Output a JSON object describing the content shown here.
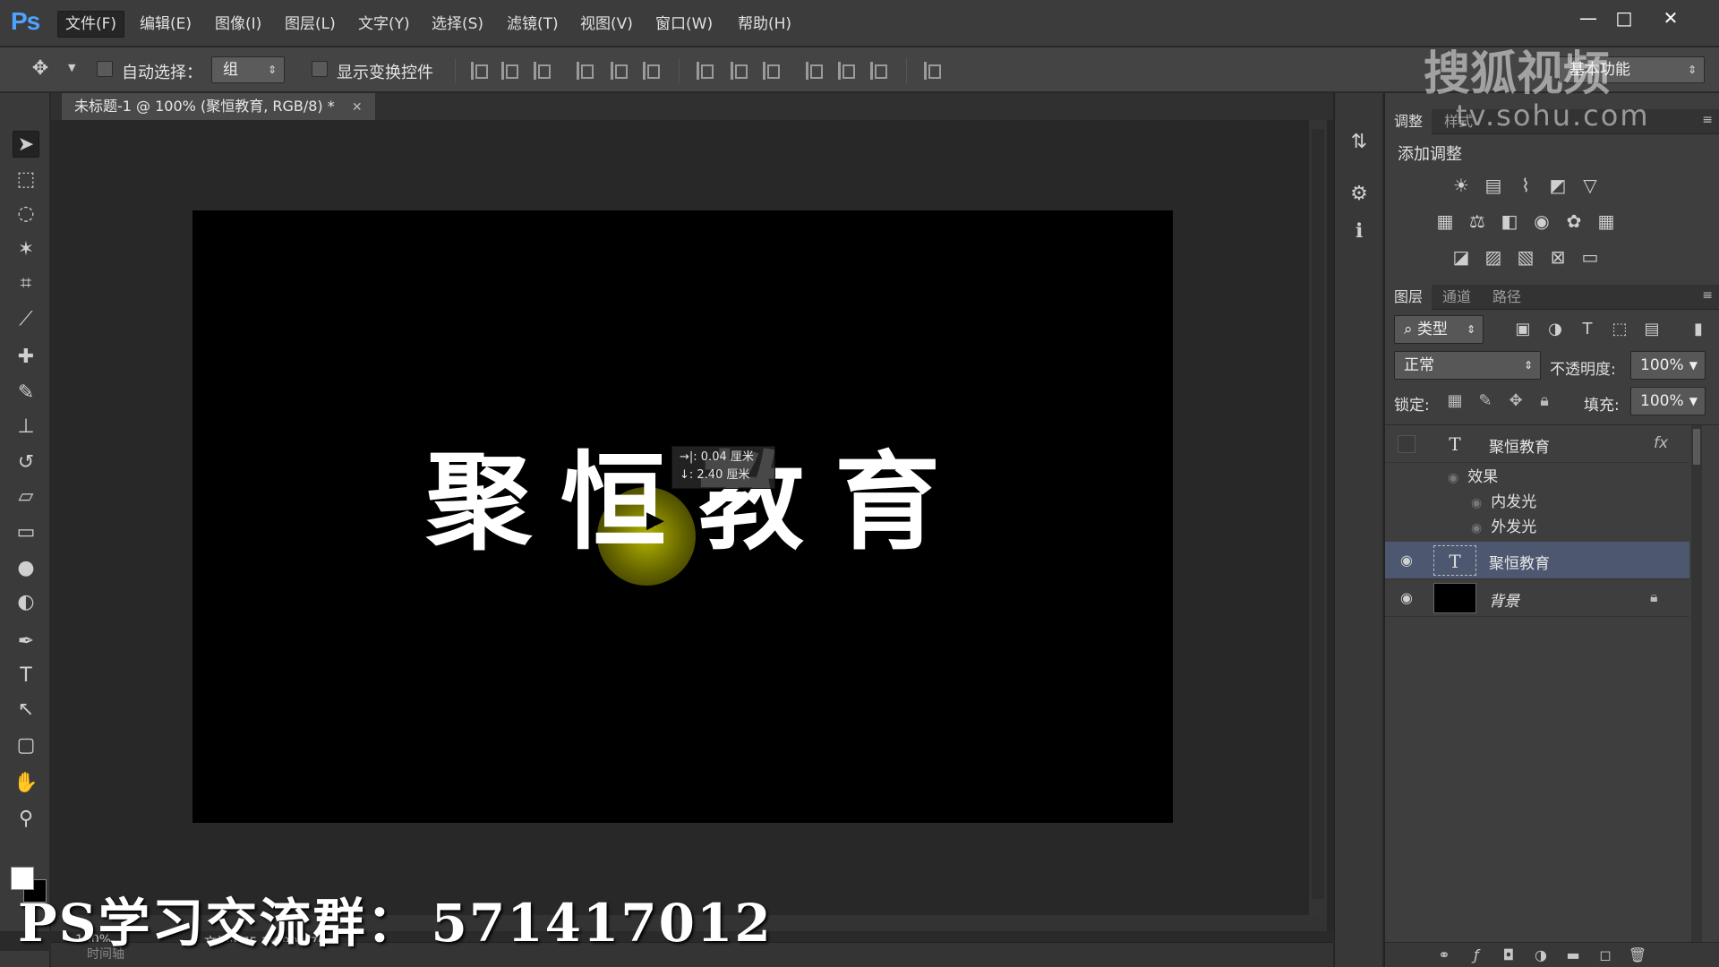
{
  "app": {
    "logo": "Ps",
    "menu": [
      "文件(F)",
      "编辑(E)",
      "图像(I)",
      "图层(L)",
      "文字(Y)",
      "选择(S)",
      "滤镜(T)",
      "视图(V)",
      "窗口(W)",
      "帮助(H)"
    ],
    "window_controls": [
      "—",
      "□",
      "✕"
    ]
  },
  "options_bar": {
    "auto_select_label": "自动选择：",
    "auto_select_value": "组",
    "show_transform_label": "显示变换控件",
    "workspace_value": "基本功能"
  },
  "document": {
    "tab_title": "未标题-1 @ 100% (聚恒教育, RGB/8) *",
    "canvas_chars": [
      "聚",
      "恒",
      "教",
      "育"
    ],
    "measure_tip": {
      "line1": "→|: 0.04 厘米",
      "line2": "↓: 2.40 厘米"
    },
    "status_zoom": "100%",
    "status_doc": "文档:975.3K/909.7K",
    "timeline_label": "时间轴"
  },
  "adjustments": {
    "tabs": [
      "调整",
      "样式"
    ],
    "add_label": "添加调整"
  },
  "layers": {
    "tabs": [
      "图层",
      "通道",
      "路径"
    ],
    "filter_kind": "类型",
    "blend_mode": "正常",
    "opacity_label": "不透明度:",
    "opacity_value": "100%",
    "lock_label": "锁定:",
    "fill_label": "填充:",
    "fill_value": "100%",
    "rows": [
      {
        "name": "聚恒教育",
        "fx": "fx"
      },
      {
        "name": "效果"
      },
      {
        "name": "内发光"
      },
      {
        "name": "外发光"
      },
      {
        "name": "聚恒教育"
      },
      {
        "name": "背景"
      }
    ]
  },
  "overlay": {
    "watermark_main": "搜狐视频",
    "watermark_sub": "tv.sohu.com",
    "caption": "PS学习交流群：",
    "group_number": "571417012"
  },
  "colors": {
    "accent_blue": "#4fa3ff",
    "selected_layer": "#4d5870",
    "cursor_highlight": "#c8c800"
  }
}
